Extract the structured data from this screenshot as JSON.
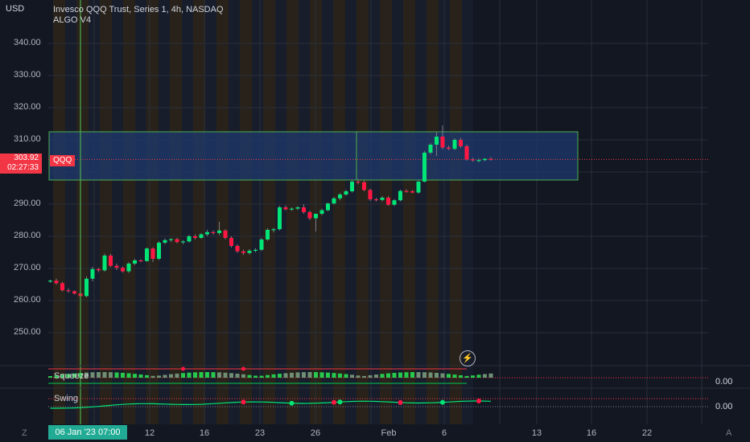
{
  "header": {
    "currency": "USD",
    "title": "Invesco QQQ Trust, Series 1, 4h, NASDAQ",
    "indicator": "ALGO V4"
  },
  "price_tag": {
    "price": "303.92",
    "countdown": "02:27:33",
    "symbol": "QQQ"
  },
  "crosshair_date": "06 Jan '23  07:00",
  "y_axis": [
    "340.00",
    "330.00",
    "320.00",
    "310.00",
    "290.00",
    "280.00",
    "270.00",
    "260.00",
    "250.00"
  ],
  "x_axis": [
    "12",
    "16",
    "23",
    "26",
    "Feb",
    "6",
    "13",
    "16",
    "22"
  ],
  "corner_left": "Z",
  "corner_right": "A",
  "indicators": {
    "squeeze": {
      "label": "Squeeze",
      "value": "0.00"
    },
    "swing": {
      "label": "Swing",
      "value": "0.00"
    }
  },
  "colors": {
    "background": "#131722",
    "up": "#00e676",
    "down": "#ff1744",
    "zone": "#1e3a6e",
    "crosshair": "#4caf50",
    "price_tag": "#f23645"
  },
  "chart_data": {
    "type": "candlestick",
    "title": "Invesco QQQ Trust, Series 1, 4h, NASDAQ",
    "ylim": [
      240,
      345
    ],
    "zone": [
      297.5,
      312.5
    ],
    "last_price": 303.92,
    "candles": [
      [
        266.0,
        266.5,
        265.5,
        266.2
      ],
      [
        266.2,
        266.8,
        265.0,
        265.4
      ],
      [
        265.4,
        265.8,
        262.8,
        263.2
      ],
      [
        263.2,
        263.8,
        262.4,
        262.9
      ],
      [
        262.9,
        263.2,
        261.9,
        262.2
      ],
      [
        262.2,
        262.6,
        261.0,
        261.4
      ],
      [
        261.4,
        267.5,
        261.0,
        266.8
      ],
      [
        266.8,
        270.5,
        266.0,
        269.8
      ],
      [
        269.8,
        270.2,
        268.8,
        269.4
      ],
      [
        269.4,
        274.6,
        269.0,
        274.0
      ],
      [
        274.0,
        274.5,
        270.4,
        270.8
      ],
      [
        270.8,
        271.5,
        269.5,
        270.2
      ],
      [
        270.2,
        270.6,
        268.7,
        269.1
      ],
      [
        269.1,
        272.0,
        268.6,
        271.5
      ],
      [
        271.5,
        273.0,
        271.0,
        272.5
      ],
      [
        272.5,
        272.9,
        272.0,
        272.3
      ],
      [
        272.3,
        276.5,
        272.0,
        276.2
      ],
      [
        276.2,
        276.6,
        272.0,
        273.0
      ],
      [
        273.0,
        278.5,
        272.6,
        278.0
      ],
      [
        278.0,
        279.3,
        277.5,
        278.8
      ],
      [
        278.8,
        279.4,
        278.2,
        279.1
      ],
      [
        279.1,
        279.5,
        277.8,
        278.2
      ],
      [
        278.2,
        278.8,
        277.5,
        278.4
      ],
      [
        278.4,
        280.5,
        278.0,
        280.0
      ],
      [
        280.0,
        280.6,
        279.0,
        279.5
      ],
      [
        279.5,
        281.0,
        279.2,
        280.6
      ],
      [
        280.6,
        282.0,
        280.0,
        281.3
      ],
      [
        281.3,
        281.8,
        280.5,
        281.0
      ],
      [
        281.0,
        284.5,
        280.4,
        281.8
      ],
      [
        281.8,
        282.2,
        279.0,
        279.5
      ],
      [
        279.5,
        280.0,
        276.5,
        277.0
      ],
      [
        277.0,
        277.5,
        274.8,
        275.3
      ],
      [
        275.3,
        275.8,
        274.2,
        274.8
      ],
      [
        274.8,
        276.0,
        274.3,
        275.5
      ],
      [
        275.5,
        276.3,
        275.0,
        275.8
      ],
      [
        275.8,
        279.5,
        275.4,
        279.0
      ],
      [
        279.0,
        282.5,
        278.6,
        282.0
      ],
      [
        282.0,
        282.6,
        281.2,
        282.2
      ],
      [
        282.2,
        289.5,
        281.8,
        289.0
      ],
      [
        289.0,
        289.6,
        288.0,
        288.4
      ],
      [
        288.4,
        289.0,
        287.9,
        288.6
      ],
      [
        288.6,
        289.3,
        288.2,
        289.0
      ],
      [
        289.0,
        290.0,
        287.0,
        287.5
      ],
      [
        287.5,
        288.0,
        285.0,
        285.6
      ],
      [
        285.6,
        286.0,
        281.5,
        287.0
      ],
      [
        287.0,
        288.6,
        286.5,
        288.1
      ],
      [
        288.1,
        290.5,
        287.8,
        290.2
      ],
      [
        290.2,
        292.2,
        289.8,
        291.8
      ],
      [
        291.8,
        293.5,
        291.2,
        293.0
      ],
      [
        293.0,
        294.5,
        292.6,
        294.0
      ],
      [
        294.0,
        297.5,
        293.6,
        297.0
      ],
      [
        297.0,
        297.8,
        296.2,
        296.8
      ],
      [
        296.8,
        297.3,
        294.0,
        294.4
      ],
      [
        294.4,
        294.8,
        291.0,
        291.5
      ],
      [
        291.5,
        292.0,
        290.8,
        291.3
      ],
      [
        291.3,
        292.5,
        290.8,
        292.0
      ],
      [
        292.0,
        292.5,
        289.5,
        289.8
      ],
      [
        289.8,
        291.6,
        289.4,
        291.2
      ],
      [
        291.2,
        294.5,
        290.8,
        294.1
      ],
      [
        294.1,
        294.6,
        293.5,
        294.0
      ],
      [
        294.0,
        294.4,
        293.4,
        293.6
      ],
      [
        293.6,
        297.5,
        293.2,
        297.0
      ],
      [
        297.0,
        306.5,
        296.8,
        306.0
      ],
      [
        306.0,
        309.0,
        305.5,
        308.5
      ],
      [
        308.5,
        312.5,
        305.0,
        311.0
      ],
      [
        311.0,
        314.5,
        307.0,
        307.6
      ],
      [
        307.6,
        308.2,
        306.8,
        307.2
      ],
      [
        307.2,
        310.5,
        306.8,
        310.0
      ],
      [
        310.0,
        310.6,
        307.5,
        308.0
      ],
      [
        308.0,
        308.5,
        303.5,
        303.9
      ],
      [
        303.9,
        304.4,
        303.2,
        303.6
      ],
      [
        303.6,
        304.2,
        303.0,
        303.7
      ],
      [
        303.7,
        304.3,
        303.3,
        304.1
      ],
      [
        304.1,
        304.6,
        303.5,
        303.92
      ]
    ],
    "squeeze_markers": [
      {
        "bar": 22,
        "color": "red"
      },
      {
        "bar": 32,
        "color": "red"
      }
    ],
    "swing_markers": [
      {
        "bar": 32,
        "color": "red"
      },
      {
        "bar": 40,
        "color": "green"
      },
      {
        "bar": 47,
        "color": "red"
      },
      {
        "bar": 48,
        "color": "green"
      },
      {
        "bar": 58,
        "color": "red"
      },
      {
        "bar": 65,
        "color": "green"
      },
      {
        "bar": 71,
        "color": "red"
      }
    ]
  }
}
